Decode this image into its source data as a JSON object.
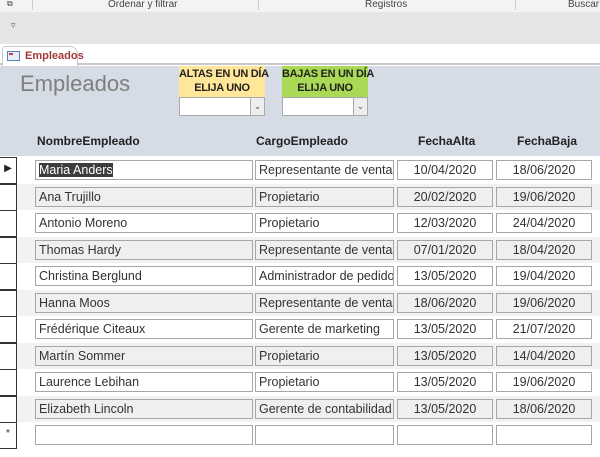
{
  "ribbon": {
    "groups": [
      "Ordenar y filtrar",
      "Registros",
      "Buscar"
    ]
  },
  "tab": {
    "label": "Empleados"
  },
  "form": {
    "title": "Empleados",
    "altas": {
      "label1": "ALTAS EN UN DÍA",
      "label2": "ELIJA UNO",
      "value": "",
      "color": "#ffe699"
    },
    "bajas": {
      "label1": "BAJAS EN UN DÍA",
      "label2": "ELIJA UNO",
      "value": "",
      "color": "#a9d955"
    },
    "columns": [
      "NombreEmpleado",
      "CargoEmpleado",
      "FechaAlta",
      "FechaBaja"
    ],
    "rows": [
      [
        "Maria Anders",
        "Representante de ventas",
        "10/04/2020",
        "18/06/2020"
      ],
      [
        "Ana Trujillo",
        "Propietario",
        "20/02/2020",
        "19/06/2020"
      ],
      [
        "Antonio Moreno",
        "Propietario",
        "12/03/2020",
        "24/04/2020"
      ],
      [
        "Thomas Hardy",
        "Representante de ventas",
        "07/01/2020",
        "18/04/2020"
      ],
      [
        "Christina Berglund",
        "Administrador de pedidos",
        "13/05/2020",
        "19/04/2020"
      ],
      [
        "Hanna Moos",
        "Representante de ventas",
        "18/06/2020",
        "19/06/2020"
      ],
      [
        "Frédérique Citeaux",
        "Gerente de marketing",
        "13/05/2020",
        "21/07/2020"
      ],
      [
        "Martín Sommer",
        "Propietario",
        "13/05/2020",
        "14/04/2020"
      ],
      [
        "Laurence Lebihan",
        "Propietario",
        "13/05/2020",
        "19/06/2020"
      ],
      [
        "Elizabeth Lincoln",
        "Gerente de contabilidad",
        "13/05/2020",
        "18/06/2020"
      ]
    ],
    "new_row_marker": "*",
    "current_marker": "▶"
  }
}
